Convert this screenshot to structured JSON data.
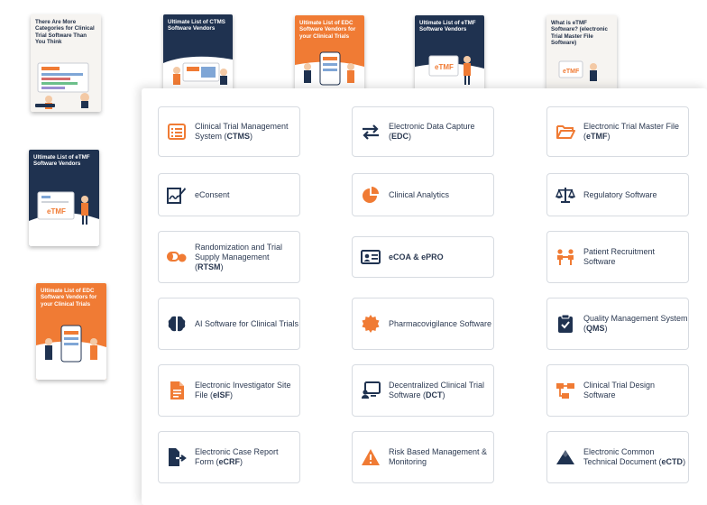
{
  "books": [
    {
      "title": "There Are More Categories for Clinical Trial Software Than You Think",
      "art": "Dashboard illustration"
    },
    {
      "title": "Ultimate List of  CTMS Software Vendors",
      "art": "CTMS illustration"
    },
    {
      "title": "Ultimate List of EDC Software Vendors for your Clinical Trials",
      "art": "EDC illustration"
    },
    {
      "title": "Ultimate List of eTMF Software Vendors",
      "art_text": "eTMF"
    },
    {
      "title": "What is eTMF Software? (electronic Trial Master File Software)",
      "art_text": "eTMF"
    },
    {
      "title": "Ultimate List of eTMF Software Vendors",
      "art_text": "eTMF"
    },
    {
      "title": "Ultimate List of EDC Software Vendors for your Clinical Trials",
      "art": "EDC illustration"
    }
  ],
  "categories": [
    {
      "pre": "Clinical Trial Management System (",
      "abbr": "CTMS",
      "post": ")",
      "icon": "list-icon"
    },
    {
      "pre": "Electronic Data Capture (",
      "abbr": "EDC",
      "post": ")",
      "icon": "transfer-arrows-icon"
    },
    {
      "pre": "Electronic Trial Master File (",
      "abbr": "eTMF",
      "post": ")",
      "icon": "folder-icon"
    },
    {
      "pre": "eConsent",
      "abbr": "",
      "post": "",
      "icon": "signature-icon"
    },
    {
      "pre": "Clinical Analytics",
      "abbr": "",
      "post": "",
      "icon": "pie-chart-icon"
    },
    {
      "pre": "Regulatory Software",
      "abbr": "",
      "post": "",
      "icon": "scales-icon"
    },
    {
      "pre": "Randomization and Trial Supply Management (",
      "abbr": "RTSM",
      "post": ")",
      "icon": "pills-icon"
    },
    {
      "pre": "eCOA & ePRO",
      "abbr": "",
      "post": "",
      "icon": "id-card-icon"
    },
    {
      "pre": "Patient Recruitment Software",
      "abbr": "",
      "post": "",
      "icon": "people-icon"
    },
    {
      "pre": "AI Software for Clinical Trials",
      "abbr": "",
      "post": "",
      "icon": "brain-icon"
    },
    {
      "pre": "Pharmacovigilance Software",
      "abbr": "",
      "post": "",
      "icon": "badge-icon"
    },
    {
      "pre": "Quality Management System (",
      "abbr": "QMS",
      "post": ")",
      "icon": "clipboard-check-icon"
    },
    {
      "pre": "Electronic Investigator Site File (",
      "abbr": "eISF",
      "post": ")",
      "icon": "document-icon"
    },
    {
      "pre": "Decentralized Clinical Trial Software (",
      "abbr": "DCT",
      "post": ")",
      "icon": "remote-monitor-icon"
    },
    {
      "pre": "Clinical Trial Design Software",
      "abbr": "",
      "post": "",
      "icon": "flow-diagram-icon"
    },
    {
      "pre": "Electronic Case Report Form (",
      "abbr": "eCRF",
      "post": ")",
      "icon": "file-export-icon"
    },
    {
      "pre": "Risk Based Management & Monitoring",
      "abbr": "",
      "post": "",
      "icon": "warning-icon"
    },
    {
      "pre": "Electronic Common Technical Document (",
      "abbr": "eCTD",
      "post": ")",
      "icon": "mountain-icon"
    }
  ],
  "colors": {
    "orange": "#f07b34",
    "navy": "#1f3250",
    "card_border": "#d7dbe1",
    "text": "#2c3a52"
  }
}
